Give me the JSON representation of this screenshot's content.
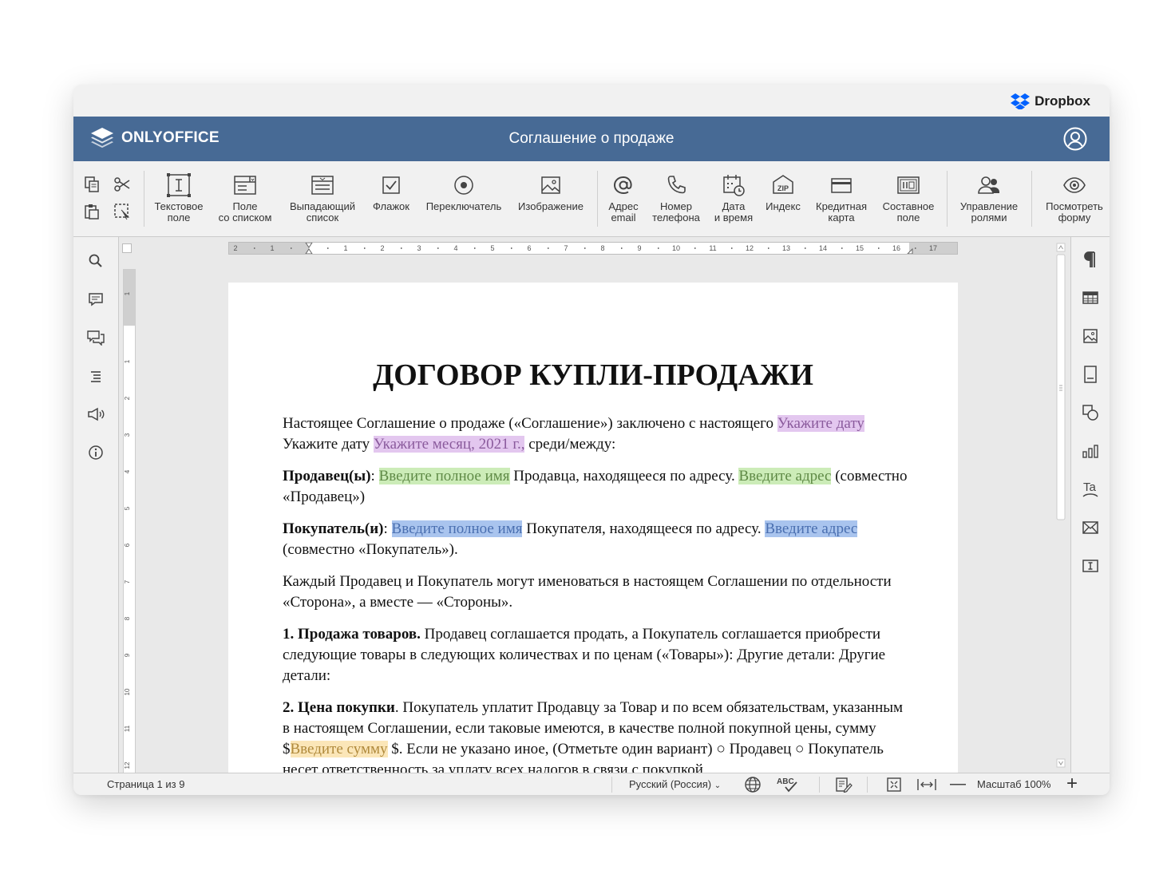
{
  "dropbox": {
    "label": "Dropbox"
  },
  "app": {
    "logo": "ONLYOFFICE",
    "title": "Соглашение о продаже"
  },
  "toolbar": {
    "buttons": [
      {
        "label": "Текстовое\nполе",
        "icon": "text-field-icon"
      },
      {
        "label": "Поле\nсо списком",
        "icon": "combo-box-icon"
      },
      {
        "label": "Выпадающий\nсписок",
        "icon": "dropdown-list-icon"
      },
      {
        "label": "Флажок",
        "icon": "checkbox-icon"
      },
      {
        "label": "Переключатель",
        "icon": "radio-button-icon"
      },
      {
        "label": "Изображение",
        "icon": "image-icon"
      },
      {
        "label": "Адрес\nemail",
        "icon": "at-icon"
      },
      {
        "label": "Номер\nтелефона",
        "icon": "phone-icon"
      },
      {
        "label": "Дата\nи время",
        "icon": "calendar-clock-icon"
      },
      {
        "label": "Индекс",
        "icon": "zip-icon"
      },
      {
        "label": "Кредитная\nкарта",
        "icon": "credit-card-icon"
      },
      {
        "label": "Составное\nполе",
        "icon": "complex-field-icon"
      },
      {
        "label": "Управление\nролями",
        "icon": "users-icon"
      },
      {
        "label": "Посмотреть\nформу",
        "icon": "eye-icon"
      }
    ]
  },
  "ruler": {
    "numbers": [
      "2",
      "1",
      "1",
      "2",
      "3",
      "4",
      "5",
      "6",
      "7",
      "8",
      "9",
      "10",
      "11",
      "12",
      "13",
      "14",
      "15",
      "16",
      "17"
    ],
    "v_numbers": [
      "1",
      "1",
      "2",
      "3",
      "4",
      "5",
      "6",
      "7",
      "8",
      "9",
      "10",
      "11",
      "12"
    ]
  },
  "document": {
    "heading": "ДОГОВОР КУПЛИ-ПРОДАЖИ",
    "p1": {
      "t1": "Настоящее Соглашение о продаже («Соглашение») заключено с настоящего ",
      "f1": "Укажите дату",
      "t2": " Укажите дату ",
      "f2": "Укажите месяц, 2021 г.,",
      "t3": " среди/между:"
    },
    "p2": {
      "b": "Продавец(ы)",
      "t1": ": ",
      "f1": "Введите полное имя",
      "t2": " Продавца, находящееся по адресу. ",
      "f2": "Введите адрес",
      "t3": " (совместно «Продавец»)"
    },
    "p3": {
      "b": "Покупатель(и)",
      "t1": ": ",
      "f1": "Введите полное имя",
      "t2": " Покупателя, находящееся по адресу. ",
      "f2": "Введите адрес",
      "t3": " (совместно «Покупатель»)."
    },
    "p4": {
      "t1": "Каждый Продавец и Покупатель могут именоваться в настоящем Соглашении по отдельности «Сторона», а вместе — «Стороны»."
    },
    "p5": {
      "b": "1. Продажа товаров.",
      "t1": " Продавец соглашается продать, а Покупатель соглашается приобрести следующие товары в следующих количествах и по ценам («Товары»): Другие детали: Другие детали:"
    },
    "p6": {
      "b": "2. Цена покупки",
      "t1": ". Покупатель уплатит Продавцу за Товар и по всем обязательствам, указанным в настоящем Соглашении, если таковые имеются, в качестве полной покупной цены, сумму $",
      "f1": "Введите сумму",
      "t2": " $. Если не указано иное, (Отметьте один вариант) ○ Продавец ○ Покупатель несет ответственность за уплату всех налогов в связи с покупкой"
    }
  },
  "status": {
    "page": "Страница 1 из 9",
    "language": "Русский (Россия)",
    "zoom": "Масштаб 100%"
  },
  "colors": {
    "header": "#476a95",
    "pink": "#e3c7ef",
    "green": "#ccecb8",
    "blue": "#a9c4ee",
    "orange": "#fbe6b8"
  }
}
